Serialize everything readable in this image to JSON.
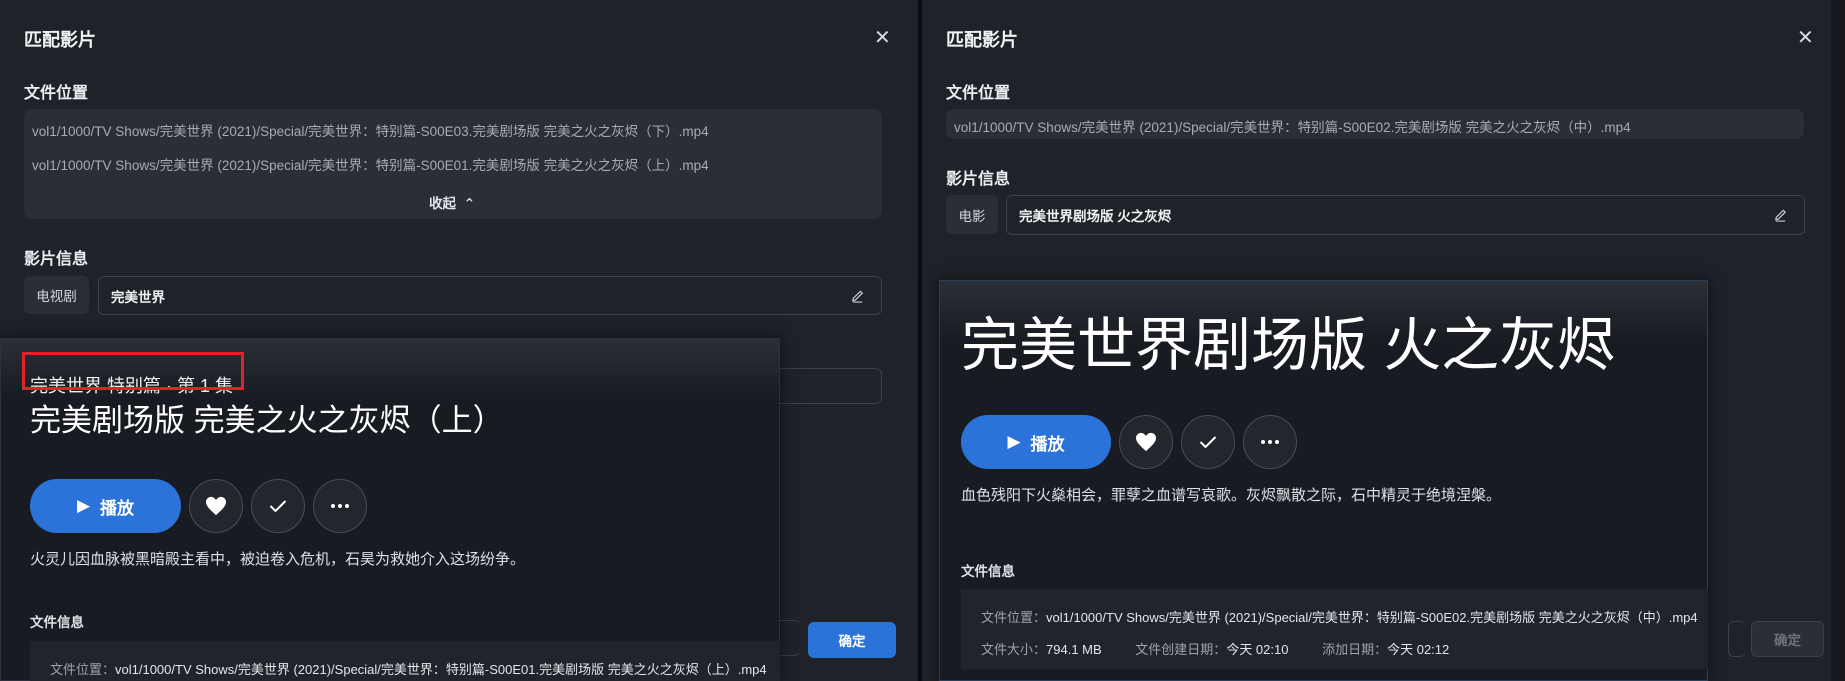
{
  "left": {
    "dialog_title": "匹配影片",
    "file_location_label": "文件位置",
    "paths": [
      "vol1/1000/TV Shows/完美世界 (2021)/Special/完美世界：特别篇-S00E03.完美剧场版 完美之火之灰烬（下）.mp4",
      "vol1/1000/TV Shows/完美世界 (2021)/Special/完美世界：特别篇-S00E01.完美剧场版 完美之火之灰烬（上）.mp4"
    ],
    "collapse_label": "收起",
    "media_info_label": "影片信息",
    "media_type": "电视剧",
    "media_name": "完美世界",
    "confirm_label": "确定"
  },
  "left_card": {
    "subtitle": "完美世界 特别篇 · 第 1 集",
    "title": "完美剧场版 完美之火之灰烬（上）",
    "play_label": "播放",
    "description": "火灵儿因血脉被黑暗殿主看中，被迫卷入危机，石昊为救她介入这场纷争。",
    "file_info_label": "文件信息",
    "file_location_key": "文件位置：",
    "file_location_value": "vol1/1000/TV Shows/完美世界 (2021)/Special/完美世界：特别篇-S00E01.完美剧场版 完美之火之灰烬（上）.mp4"
  },
  "right": {
    "dialog_title": "匹配影片",
    "file_location_label": "文件位置",
    "path": "vol1/1000/TV Shows/完美世界 (2021)/Special/完美世界：特别篇-S00E02.完美剧场版 完美之火之灰烬（中）.mp4",
    "media_info_label": "影片信息",
    "media_type": "电影",
    "media_name": "完美世界剧场版 火之灰烬",
    "confirm_label": "确定"
  },
  "right_card": {
    "title": "完美世界剧场版 火之灰烬",
    "play_label": "播放",
    "description": "血色残阳下火燊相会，罪孽之血谱写哀歌。灰烬飘散之际，石中精灵于绝境涅槃。",
    "file_info_label": "文件信息",
    "file_location_key": "文件位置：",
    "file_location_value": "vol1/1000/TV Shows/完美世界 (2021)/Special/完美世界：特别篇-S00E02.完美剧场版 完美之火之灰烬（中）.mp4",
    "file_size_key": "文件大小：",
    "file_size_value": "794.1 MB",
    "created_key": "文件创建日期：",
    "created_value": "今天 02:10",
    "added_key": "添加日期：",
    "added_value": "今天 02:12"
  },
  "colors": {
    "accent": "#2c73d9",
    "highlight_box": "#e0232a",
    "panel_bg": "#1f2229"
  }
}
